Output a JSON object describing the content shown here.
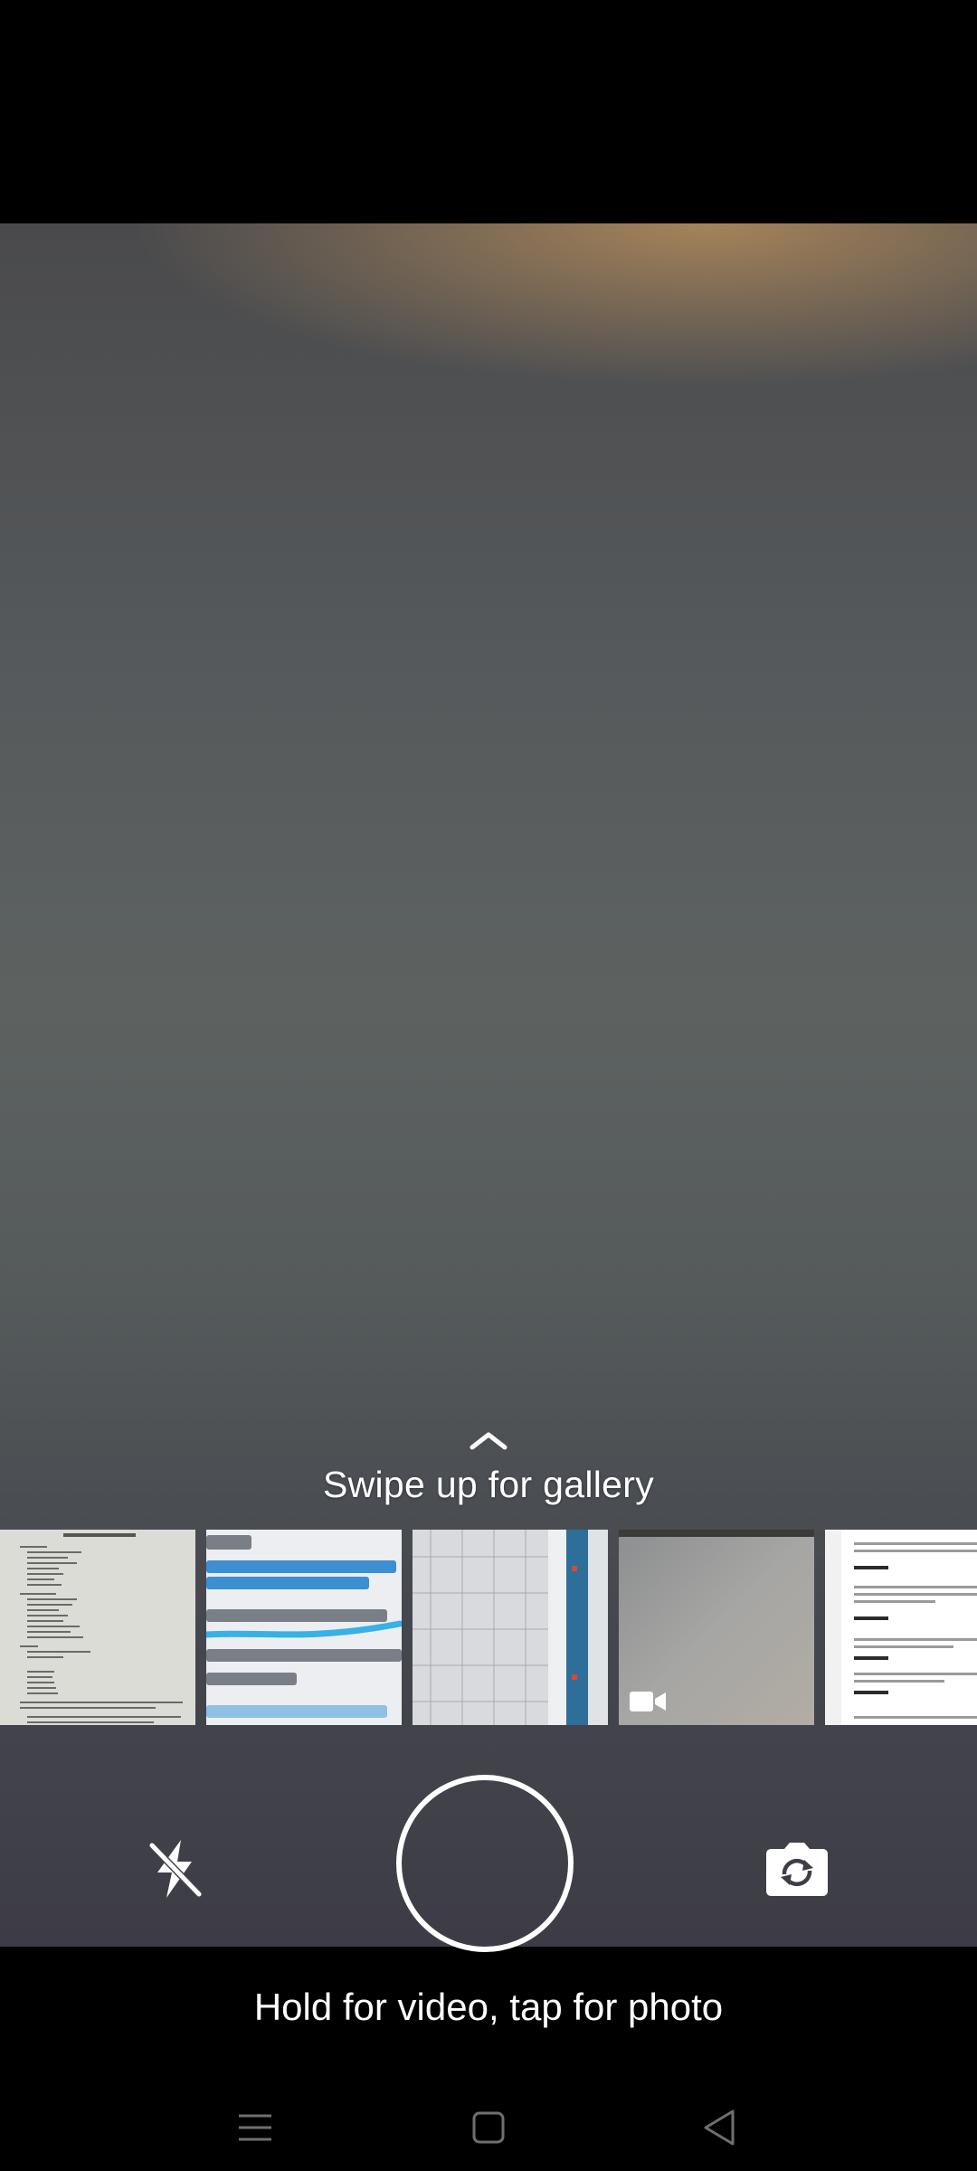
{
  "gallery_hint": {
    "icon": "chevron-up-icon",
    "text": "Swipe up for gallery"
  },
  "thumbnails": [
    {
      "kind": "photo",
      "subject": "printed document page"
    },
    {
      "kind": "photo",
      "subject": "monitor screen with URL text"
    },
    {
      "kind": "photo",
      "subject": "monitor screen with spreadsheet"
    },
    {
      "kind": "video",
      "subject": "grey surface",
      "icon": "video-camera-icon"
    },
    {
      "kind": "photo",
      "subject": "app activity list screenshot"
    }
  ],
  "controls": {
    "flash_icon": "flash-off-icon",
    "shutter_icon": "shutter-button",
    "switch_icon": "camera-switch-icon"
  },
  "instruction": "Hold for video, tap for photo",
  "navbar": {
    "items": [
      "menu-icon",
      "home-icon",
      "back-icon"
    ]
  },
  "colors": {
    "background": "#000000",
    "text": "#ffffff",
    "accent_blue": "#2fa6de"
  }
}
